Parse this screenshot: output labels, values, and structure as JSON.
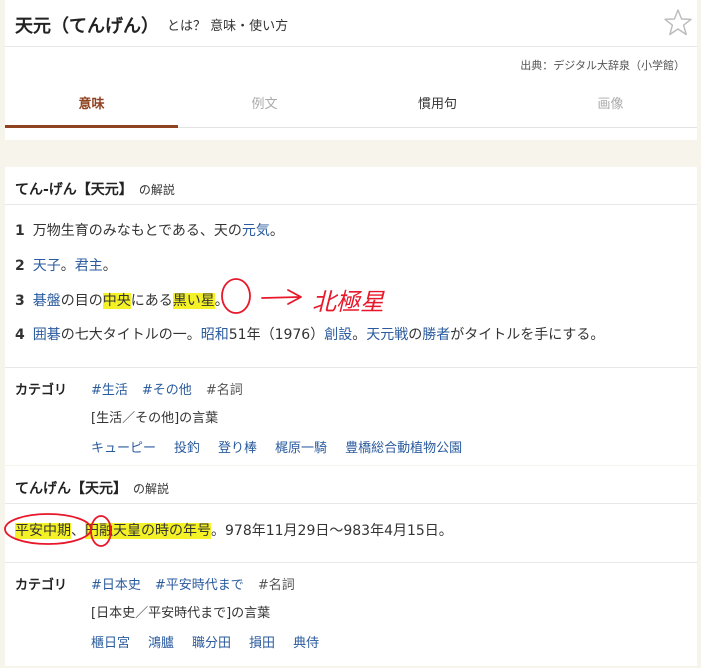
{
  "header": {
    "title": "天元（てんげん）",
    "subtitle": "とは？ 意味・使い方",
    "source": "出典：デジタル大辞泉（小学館）"
  },
  "tabs": [
    {
      "label": "意味",
      "state": "active"
    },
    {
      "label": "例文",
      "state": "disabled"
    },
    {
      "label": "慣用句",
      "state": "normal"
    },
    {
      "label": "画像",
      "state": "disabled"
    }
  ],
  "section1": {
    "title": "てん‐げん【天元】",
    "suffix": "の解説",
    "definitions": [
      {
        "num": "1",
        "parts": [
          {
            "t": "万物生育のみなもとである、天の"
          },
          {
            "t": "元気",
            "link": true
          },
          {
            "t": "。"
          }
        ]
      },
      {
        "num": "2",
        "parts": [
          {
            "t": "天子",
            "link": true
          },
          {
            "t": "。"
          },
          {
            "t": "君主",
            "link": true
          },
          {
            "t": "。"
          }
        ]
      },
      {
        "num": "3",
        "parts": [
          {
            "t": "碁盤",
            "link": true
          },
          {
            "t": "の目の"
          },
          {
            "t": "中央",
            "hl": true
          },
          {
            "t": "にある"
          },
          {
            "t": "黒い星",
            "hl": true
          },
          {
            "t": "。"
          }
        ]
      },
      {
        "num": "4",
        "parts": [
          {
            "t": "囲碁",
            "link": true
          },
          {
            "t": "の七大タイトルの一。"
          },
          {
            "t": "昭和",
            "link": true
          },
          {
            "t": "51年（1976）"
          },
          {
            "t": "創設",
            "link": true
          },
          {
            "t": "。"
          },
          {
            "t": "天元戦",
            "link": true
          },
          {
            "t": "の"
          },
          {
            "t": "勝者",
            "link": true
          },
          {
            "t": "がタイトルを手にする。"
          }
        ]
      }
    ],
    "category_label": "カテゴリ",
    "tags": [
      {
        "t": "#生活",
        "link": true
      },
      {
        "t": "#その他",
        "link": true
      },
      {
        "t": "#名詞",
        "link": false
      }
    ],
    "category_desc": "[生活／その他]の言葉",
    "related": [
      "キューピー",
      "投釣",
      "登り棒",
      "梶原一騎",
      "豊橋総合動植物公園"
    ]
  },
  "section2": {
    "title": "てんげん【天元】",
    "suffix": "の解説",
    "definition_parts": [
      {
        "t": "平安中期",
        "hl": true
      },
      {
        "t": "、"
      },
      {
        "t": "円融天皇の時の年号",
        "hl": true
      },
      {
        "t": "。978年11月29日〜983年4月15日。"
      }
    ],
    "category_label": "カテゴリ",
    "tags": [
      {
        "t": "#日本史",
        "link": true
      },
      {
        "t": "#平安時代まで",
        "link": true
      },
      {
        "t": "#名詞",
        "link": false
      }
    ],
    "category_desc": "[日本史／平安時代まで]の言葉",
    "related": [
      "櫃日宮",
      "鴻臚",
      "職分田",
      "損田",
      "典侍"
    ]
  },
  "annotation": {
    "handwritten_text": "北極星",
    "ink_color": "#e8172a"
  }
}
